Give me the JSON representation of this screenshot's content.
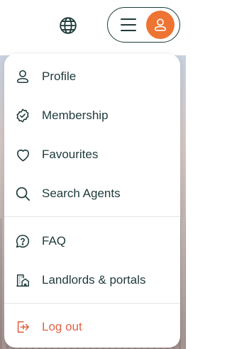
{
  "colors": {
    "accent": "#ee7434",
    "text": "#1f3a3a",
    "danger": "#e06447"
  },
  "header": {
    "language_icon": "globe-icon",
    "menu_icon": "hamburger-icon",
    "avatar_icon": "user-icon"
  },
  "menu": {
    "items": [
      {
        "label": "Profile",
        "icon": "user-icon"
      },
      {
        "label": "Membership",
        "icon": "badge-check-icon"
      },
      {
        "label": "Favourites",
        "icon": "heart-icon"
      },
      {
        "label": "Search Agents",
        "icon": "search-icon"
      }
    ],
    "items2": [
      {
        "label": "FAQ",
        "icon": "question-bubble-icon"
      },
      {
        "label": "Landlords & portals",
        "icon": "buildings-icon"
      }
    ],
    "logout": {
      "label": "Log out",
      "icon": "logout-icon"
    }
  }
}
